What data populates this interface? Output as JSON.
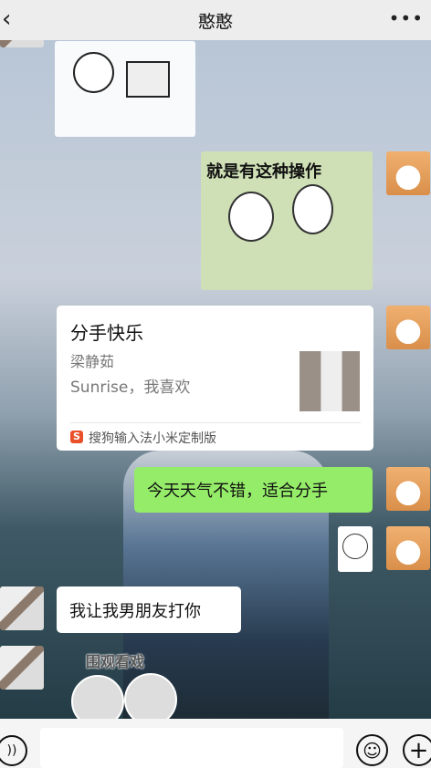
{
  "header": {
    "title": "憨憨",
    "back_icon": "chevron-left-icon",
    "more_icon": "more-icon"
  },
  "messages": [
    {
      "side": "left",
      "type": "sticker",
      "desc_icon": "computer-sticker"
    },
    {
      "side": "right",
      "type": "sticker",
      "text": "就是有这种操作"
    },
    {
      "side": "right",
      "type": "music-card",
      "title": "分手快乐",
      "artist": "梁静茹",
      "subtitle": "Sunrise，我喜欢",
      "source": "搜狗输入法小米定制版"
    },
    {
      "side": "right",
      "type": "text",
      "text": "今天天气不错，适合分手"
    },
    {
      "side": "right",
      "type": "sticker",
      "desc_icon": "blush-face-sticker"
    },
    {
      "side": "left",
      "type": "text",
      "text": "我让我男朋友打你"
    },
    {
      "side": "left",
      "type": "sticker",
      "text": "围观看戏"
    }
  ],
  "colors": {
    "header_bg": "#ededed",
    "sent_bubble": "#95ec69",
    "received_bubble": "#ffffff",
    "source_icon": "#e8512a"
  },
  "input_bar": {
    "voice_icon": "voice-icon",
    "emoji_icon": "emoji-icon",
    "plus_icon": "plus-icon",
    "value": ""
  }
}
